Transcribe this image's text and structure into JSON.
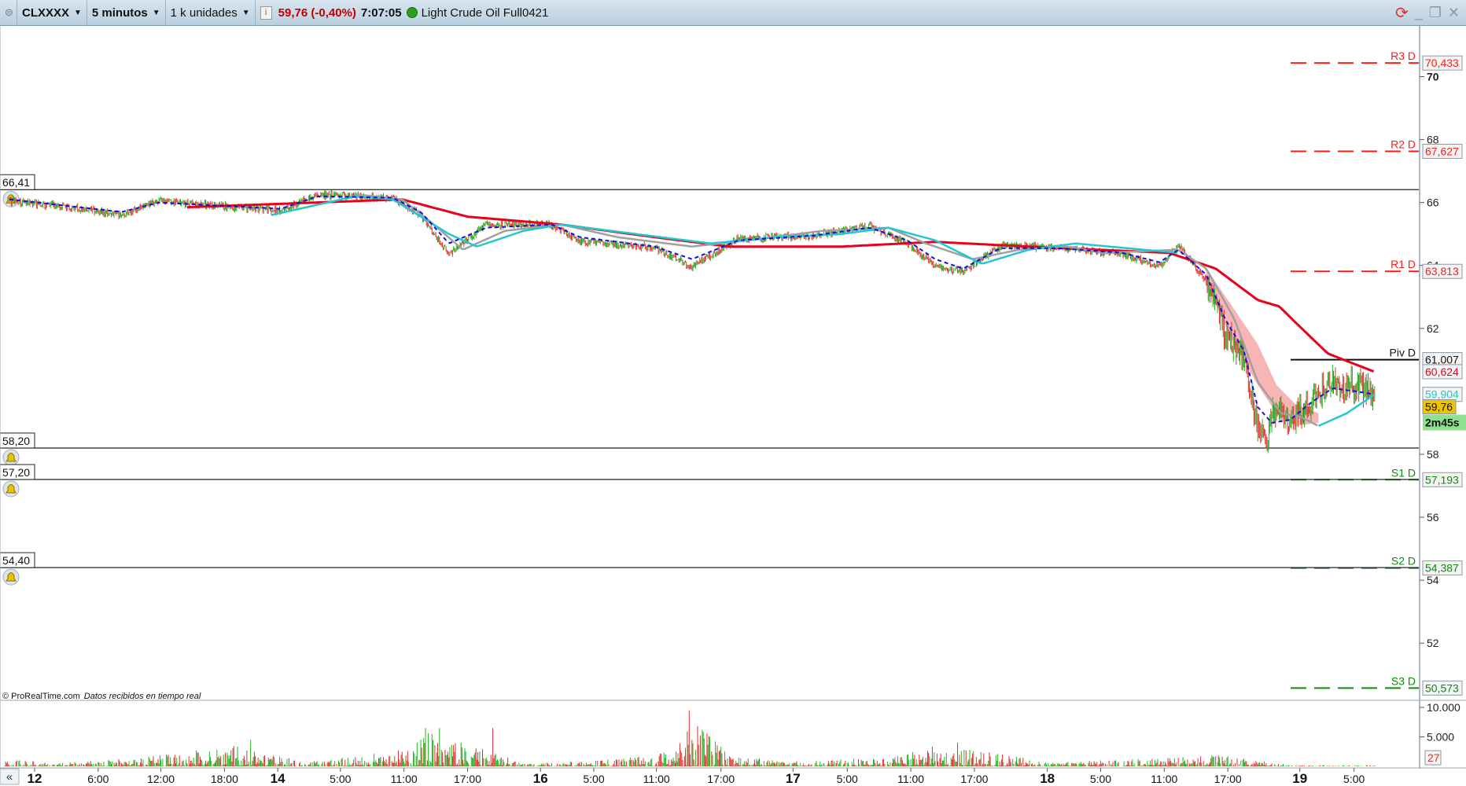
{
  "header": {
    "symbol": "CLXXXX",
    "timeframe": "5 minutos",
    "units": "1 k unidades",
    "info_icon": "i",
    "price_change": "59,76 (-0,40%)",
    "time": "7:07:05",
    "status_color": "#2ca01c",
    "instrument": "Light Crude Oil Full0421"
  },
  "footer": {
    "copyright": "© ProRealTime.com",
    "realtime_note": "Datos recibidos en tiempo real",
    "scroll_left": "«"
  },
  "colors": {
    "up": "#22b522",
    "down": "#e03030",
    "ma_red": "#e8001c",
    "ma_gray": "#a0a0a0",
    "ma_cyan": "#22c8d0",
    "ma_blue": "#1010e0",
    "cloud": "#f7a8a8",
    "resistance": "#ff1a1a",
    "support": "#0e8a0e"
  },
  "chart_data": {
    "type": "line",
    "title": "CLXXXX 5 minutos",
    "x_unit": "bar index",
    "xlim": [
      0,
      1518
    ],
    "ylim": [
      49.6,
      71.7
    ],
    "y_ticks": [
      "70",
      "68",
      "66",
      "64",
      "62",
      "58",
      "56",
      "54",
      "52"
    ],
    "y_tick_values": [
      70,
      68,
      66,
      64,
      62,
      58,
      56,
      54,
      52
    ],
    "x_ticks": [
      {
        "label": "12",
        "x": 37,
        "major": true
      },
      {
        "label": "6:00",
        "x": 105
      },
      {
        "label": "12:00",
        "x": 172
      },
      {
        "label": "18:00",
        "x": 240
      },
      {
        "label": "14",
        "x": 297,
        "major": true
      },
      {
        "label": "5:00",
        "x": 364
      },
      {
        "label": "11:00",
        "x": 432
      },
      {
        "label": "17:00",
        "x": 500
      },
      {
        "label": "16",
        "x": 578,
        "major": true
      },
      {
        "label": "5:00",
        "x": 635
      },
      {
        "label": "11:00",
        "x": 702
      },
      {
        "label": "17:00",
        "x": 771
      },
      {
        "label": "17",
        "x": 848,
        "major": true
      },
      {
        "label": "5:00",
        "x": 906
      },
      {
        "label": "11:00",
        "x": 974
      },
      {
        "label": "17:00",
        "x": 1042
      },
      {
        "label": "18",
        "x": 1120,
        "major": true
      },
      {
        "label": "5:00",
        "x": 1177
      },
      {
        "label": "11:00",
        "x": 1245
      },
      {
        "label": "17:00",
        "x": 1313
      },
      {
        "label": "19",
        "x": 1390,
        "major": true
      },
      {
        "label": "5:00",
        "x": 1448
      }
    ],
    "price": [
      [
        10,
        66.05
      ],
      [
        60,
        65.9
      ],
      [
        130,
        65.6
      ],
      [
        170,
        66.05
      ],
      [
        230,
        65.9
      ],
      [
        300,
        65.75
      ],
      [
        340,
        66.26
      ],
      [
        420,
        66.14
      ],
      [
        450,
        65.6
      ],
      [
        480,
        64.36
      ],
      [
        520,
        65.3
      ],
      [
        590,
        65.3
      ],
      [
        620,
        64.77
      ],
      [
        700,
        64.56
      ],
      [
        740,
        63.97
      ],
      [
        790,
        64.86
      ],
      [
        870,
        64.95
      ],
      [
        930,
        65.25
      ],
      [
        970,
        64.7
      ],
      [
        1000,
        63.97
      ],
      [
        1030,
        63.8
      ],
      [
        1070,
        64.64
      ],
      [
        1130,
        64.56
      ],
      [
        1200,
        64.36
      ],
      [
        1240,
        63.97
      ],
      [
        1260,
        64.64
      ],
      [
        1290,
        63.5
      ],
      [
        1310,
        61.9
      ],
      [
        1330,
        61.0
      ],
      [
        1345,
        58.77
      ],
      [
        1355,
        58.3
      ],
      [
        1360,
        59.37
      ],
      [
        1380,
        59.07
      ],
      [
        1400,
        59.5
      ],
      [
        1425,
        60.3
      ],
      [
        1450,
        60.1
      ],
      [
        1470,
        59.96
      ]
    ],
    "series": [
      {
        "name": "MA red",
        "color_key": "ma_red",
        "values": [
          [
            200,
            65.85
          ],
          [
            430,
            66.1
          ],
          [
            500,
            65.55
          ],
          [
            600,
            65.3
          ],
          [
            700,
            64.9
          ],
          [
            780,
            64.6
          ],
          [
            900,
            64.6
          ],
          [
            1000,
            64.75
          ],
          [
            1100,
            64.6
          ],
          [
            1250,
            64.4
          ],
          [
            1300,
            63.9
          ],
          [
            1345,
            62.9
          ],
          [
            1368,
            62.7
          ],
          [
            1385,
            62.2
          ],
          [
            1420,
            61.2
          ],
          [
            1470,
            60.62
          ]
        ]
      },
      {
        "name": "MA gray",
        "color_key": "ma_gray",
        "values": [
          [
            380,
            66.26
          ],
          [
            430,
            66.1
          ],
          [
            460,
            65.4
          ],
          [
            495,
            64.5
          ],
          [
            540,
            65.1
          ],
          [
            600,
            65.3
          ],
          [
            660,
            64.9
          ],
          [
            740,
            64.6
          ],
          [
            800,
            64.8
          ],
          [
            880,
            65.1
          ],
          [
            950,
            65.2
          ],
          [
            990,
            64.7
          ],
          [
            1040,
            64.2
          ],
          [
            1090,
            64.5
          ],
          [
            1140,
            64.6
          ],
          [
            1180,
            64.4
          ],
          [
            1260,
            64.5
          ],
          [
            1290,
            63.9
          ],
          [
            1320,
            62.3
          ],
          [
            1345,
            60.3
          ],
          [
            1370,
            59.3
          ],
          [
            1390,
            59.2
          ],
          [
            1410,
            58.9
          ]
        ]
      },
      {
        "name": "MA cyan",
        "color_key": "ma_cyan",
        "values": [
          [
            290,
            65.6
          ],
          [
            380,
            66.2
          ],
          [
            420,
            66.1
          ],
          [
            480,
            65.0
          ],
          [
            510,
            64.6
          ],
          [
            560,
            65.1
          ],
          [
            600,
            65.3
          ],
          [
            760,
            64.7
          ],
          [
            830,
            64.9
          ],
          [
            900,
            65.0
          ],
          [
            950,
            65.2
          ],
          [
            1000,
            64.8
          ],
          [
            1050,
            64.05
          ],
          [
            1100,
            64.5
          ],
          [
            1150,
            64.7
          ],
          [
            1260,
            64.4
          ]
        ]
      },
      {
        "name": "MA cyan recent",
        "color_key": "ma_cyan",
        "values": [
          [
            1410,
            58.9
          ],
          [
            1440,
            59.3
          ],
          [
            1470,
            59.9
          ]
        ]
      },
      {
        "name": "MA blue dashed",
        "color_key": "ma_blue",
        "values": [
          [
            10,
            66.1
          ],
          [
            130,
            65.7
          ],
          [
            170,
            66.0
          ],
          [
            300,
            65.8
          ],
          [
            340,
            66.2
          ],
          [
            420,
            66.15
          ],
          [
            450,
            65.7
          ],
          [
            480,
            64.7
          ],
          [
            520,
            65.2
          ],
          [
            590,
            65.3
          ],
          [
            620,
            64.9
          ],
          [
            700,
            64.6
          ],
          [
            740,
            64.2
          ],
          [
            790,
            64.8
          ],
          [
            870,
            64.95
          ],
          [
            930,
            65.2
          ],
          [
            970,
            64.8
          ],
          [
            1000,
            64.2
          ],
          [
            1030,
            63.9
          ],
          [
            1070,
            64.55
          ],
          [
            1130,
            64.55
          ],
          [
            1200,
            64.4
          ],
          [
            1240,
            64.1
          ],
          [
            1260,
            64.5
          ],
          [
            1290,
            63.7
          ],
          [
            1310,
            62.3
          ],
          [
            1330,
            61.3
          ],
          [
            1345,
            59.5
          ],
          [
            1360,
            59.0
          ],
          [
            1380,
            59.1
          ],
          [
            1400,
            59.6
          ],
          [
            1425,
            60.1
          ],
          [
            1450,
            60.0
          ],
          [
            1470,
            59.9
          ]
        ]
      }
    ],
    "cloud": {
      "upper": [
        [
          1290,
          63.9
        ],
        [
          1320,
          62.6
        ],
        [
          1345,
          61.5
        ],
        [
          1365,
          60.2
        ],
        [
          1385,
          59.6
        ],
        [
          1410,
          59.3
        ]
      ],
      "lower": [
        [
          1290,
          63.4
        ],
        [
          1320,
          61.5
        ],
        [
          1345,
          60.2
        ],
        [
          1365,
          59.3
        ],
        [
          1385,
          58.9
        ],
        [
          1410,
          59.0
        ]
      ]
    },
    "levels": [
      {
        "name": "R3 D",
        "value": 70.433,
        "label": "70,433",
        "kind": "resistance"
      },
      {
        "name": "R2 D",
        "value": 67.627,
        "label": "67,627",
        "kind": "resistance"
      },
      {
        "name": "R1 D",
        "value": 63.813,
        "label": "63,813",
        "kind": "resistance"
      },
      {
        "name": "Piv D",
        "value": 61.007,
        "label": "61,007",
        "kind": "pivot"
      },
      {
        "name": "S1 D",
        "value": 57.193,
        "label": "57,193",
        "kind": "support"
      },
      {
        "name": "S2 D",
        "value": 54.387,
        "label": "54,387",
        "kind": "support"
      },
      {
        "name": "S3 D",
        "value": 50.573,
        "label": "50,573",
        "kind": "support"
      }
    ],
    "alerts": [
      {
        "value": 66.41,
        "label": "66,41"
      },
      {
        "value": 58.2,
        "label": "58,20"
      },
      {
        "value": 57.2,
        "label": "57,20"
      },
      {
        "value": 54.4,
        "label": "54,40"
      }
    ],
    "markers": [
      {
        "value": 60.624,
        "label": "60,624",
        "kind": "ma_red"
      },
      {
        "value": 59.904,
        "label": "59,904",
        "kind": "ma_cyan"
      },
      {
        "value": 59.76,
        "label": "59,76",
        "kind": "last"
      }
    ],
    "countdown": "2m45s",
    "volume": {
      "ticks": [
        {
          "label": "10.000",
          "value": 10000
        },
        {
          "label": "5.000",
          "value": 5000
        }
      ],
      "last": "27",
      "envelope": [
        [
          0,
          1500
        ],
        [
          60,
          500
        ],
        [
          150,
          1500
        ],
        [
          250,
          3500
        ],
        [
          290,
          2000
        ],
        [
          330,
          800
        ],
        [
          420,
          2500
        ],
        [
          460,
          6000
        ],
        [
          520,
          3000
        ],
        [
          560,
          500
        ],
        [
          640,
          1000
        ],
        [
          720,
          2500
        ],
        [
          740,
          8000
        ],
        [
          780,
          2000
        ],
        [
          840,
          800
        ],
        [
          950,
          1500
        ],
        [
          1000,
          3500
        ],
        [
          1080,
          2000
        ],
        [
          1120,
          600
        ],
        [
          1250,
          1500
        ],
        [
          1300,
          2000
        ],
        [
          1360,
          800
        ],
        [
          1380,
          200
        ],
        [
          1470,
          200
        ]
      ],
      "spikes": [
        [
          268,
          4500
        ],
        [
          455,
          6500
        ],
        [
          470,
          6500
        ],
        [
          527,
          6500
        ],
        [
          737,
          9500
        ],
        [
          1024,
          4000
        ]
      ]
    }
  }
}
